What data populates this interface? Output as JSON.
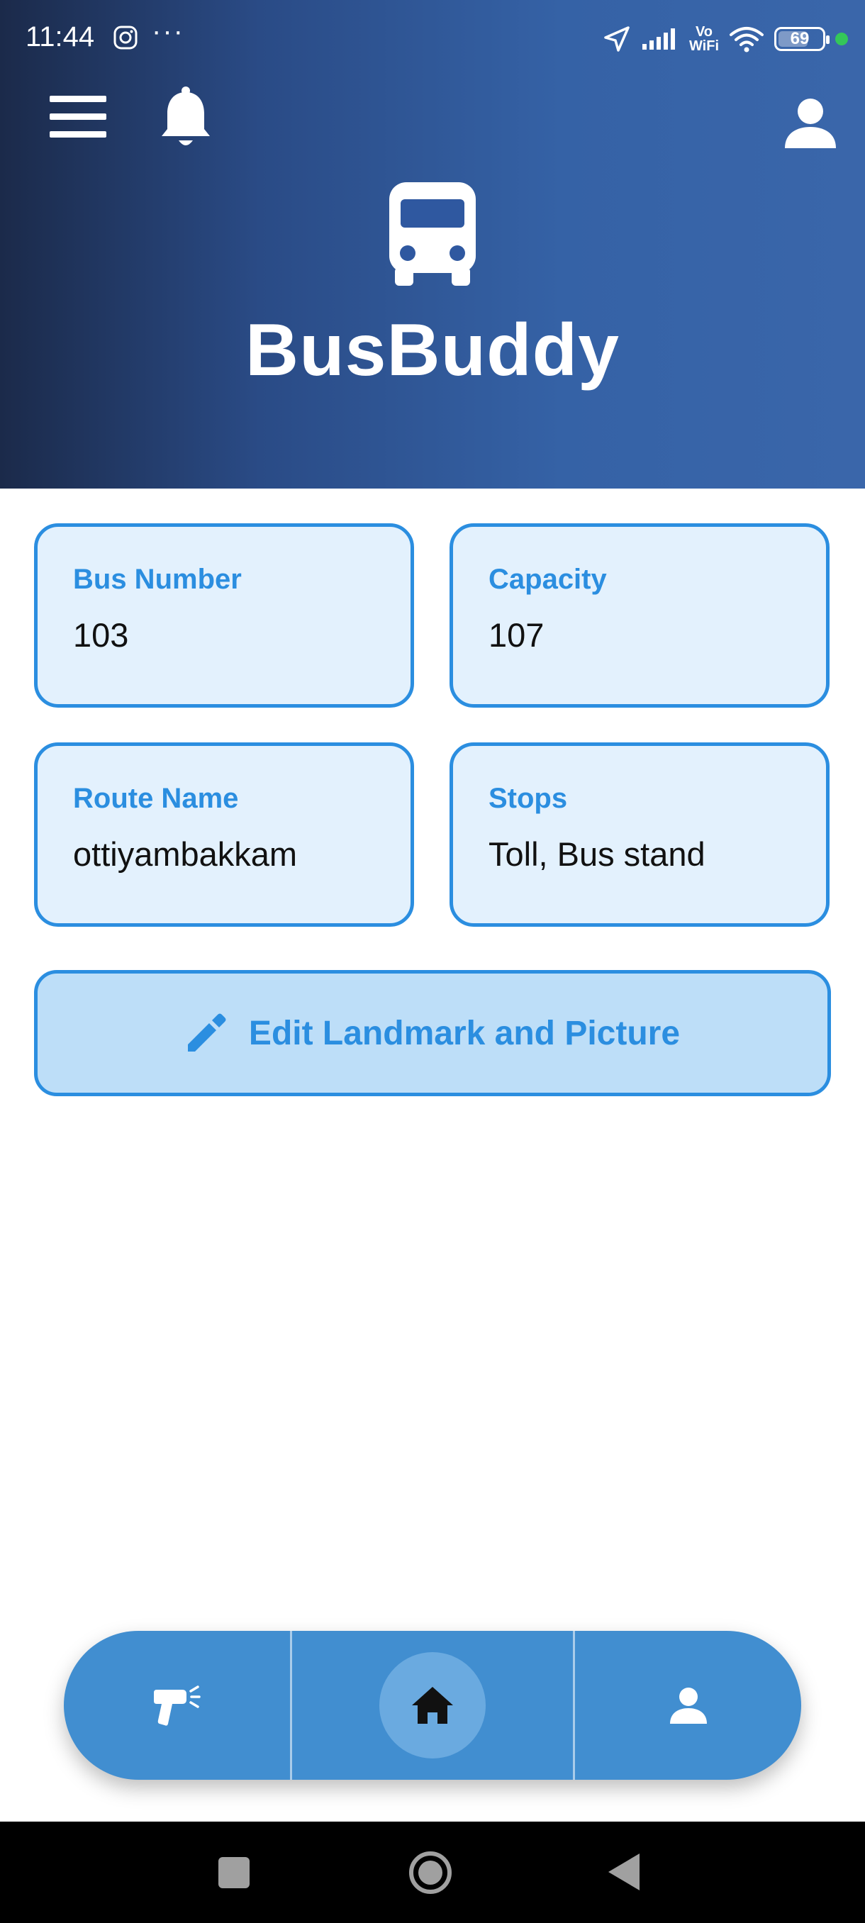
{
  "status_bar": {
    "time": "11:44",
    "more_indicator": "···",
    "network_label_top": "Vo",
    "network_label_bottom": "WiFi",
    "battery_level": "69",
    "icons": [
      "instagram-icon",
      "location-arrow-icon",
      "signal-icon",
      "wifi-icon",
      "battery-icon",
      "privacy-dot"
    ]
  },
  "header": {
    "app_title": "BusBuddy",
    "icons": [
      "menu-icon",
      "bell-icon",
      "bus-icon",
      "person-icon"
    ],
    "gradient_colors": [
      "#1b2a4a",
      "#3a66aa"
    ]
  },
  "cards": [
    {
      "label": "Bus Number",
      "value": "103"
    },
    {
      "label": "Capacity",
      "value": "107"
    },
    {
      "label": "Route Name",
      "value": "ottiyambakkam"
    },
    {
      "label": "Stops",
      "value": "Toll, Bus stand"
    }
  ],
  "edit_button": {
    "label": "Edit Landmark and Picture",
    "icon": "pencil-icon"
  },
  "bottom_nav": {
    "items": [
      {
        "name": "scan",
        "icon": "scanner-gun-icon"
      },
      {
        "name": "home",
        "icon": "home-icon",
        "active": true
      },
      {
        "name": "profile",
        "icon": "person-icon"
      }
    ]
  },
  "system_nav": {
    "icons": [
      "recents-icon",
      "home-circle-icon",
      "back-icon"
    ]
  },
  "colors": {
    "accent": "#2b8ee0",
    "card_bg": "#e3f1fd",
    "button_bg": "#bddef8",
    "nav_bg": "#418ed0"
  }
}
